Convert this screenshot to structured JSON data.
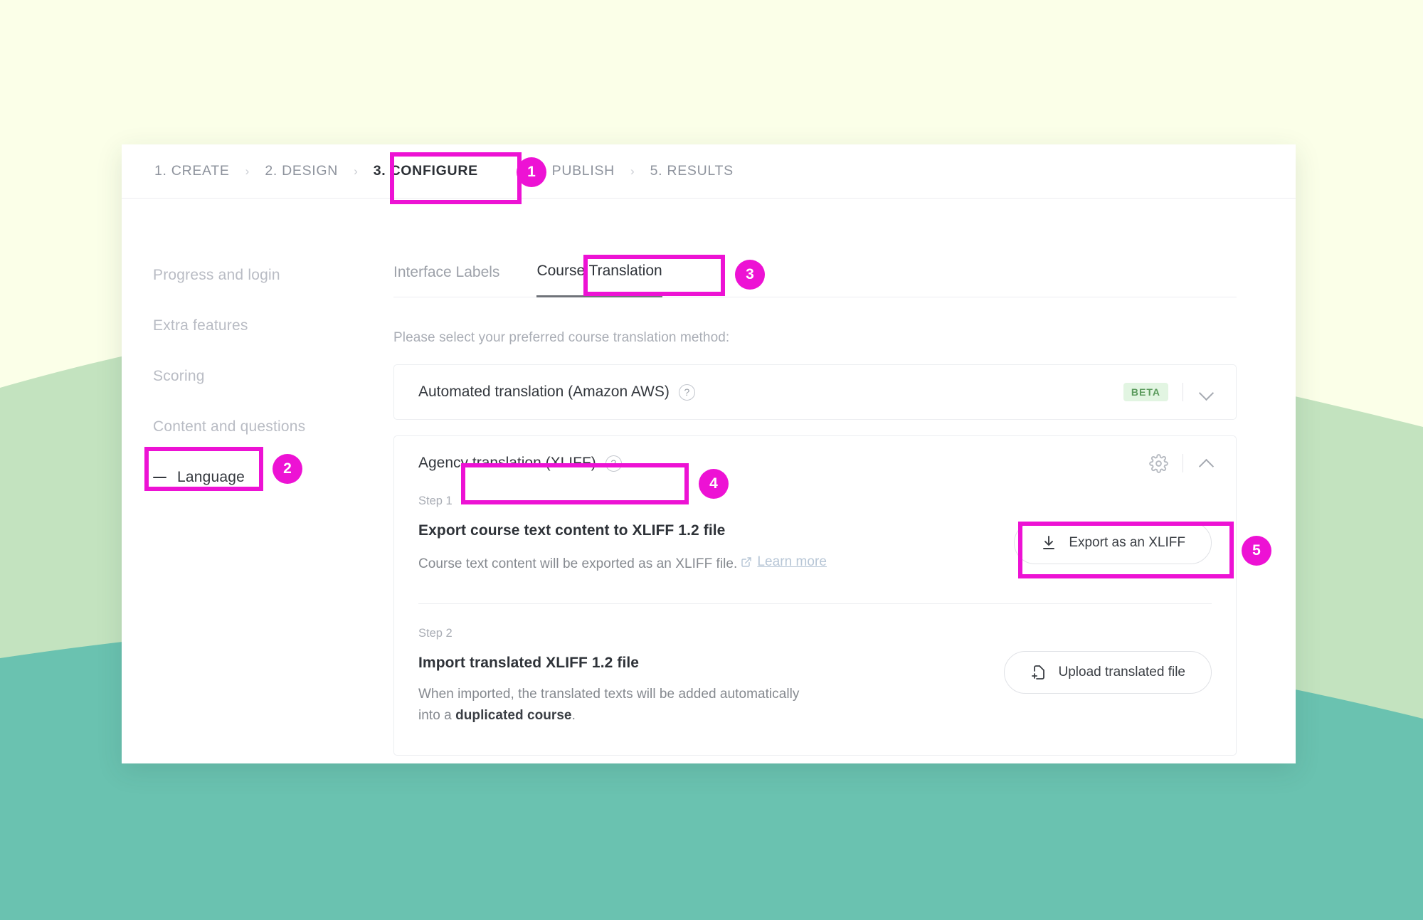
{
  "background": {
    "cream": "#fbffe8",
    "light_green": "#c3e3bf",
    "teal": "#6ac2b0"
  },
  "accent": {
    "magenta": "#ed12d4",
    "beta_green_bg": "#e2f5e2",
    "beta_green_text": "#5a9a5c",
    "link_blue": "#b7c6d6"
  },
  "steps_bar": {
    "separator": "›",
    "items": [
      {
        "label": "1. CREATE",
        "active": false
      },
      {
        "label": "2. DESIGN",
        "active": false
      },
      {
        "label": "3. CONFIGURE",
        "active": true
      },
      {
        "label": "4. PUBLISH",
        "active": false
      },
      {
        "label": "5. RESULTS",
        "active": false
      }
    ]
  },
  "side_nav": {
    "items": [
      {
        "label": "Progress and login",
        "selected": false
      },
      {
        "label": "Extra features",
        "selected": false
      },
      {
        "label": "Scoring",
        "selected": false
      },
      {
        "label": "Content and questions",
        "selected": false
      },
      {
        "label": "Language",
        "selected": true
      }
    ]
  },
  "tabs": [
    {
      "label": "Interface Labels",
      "active": false
    },
    {
      "label": "Course Translation",
      "active": true
    }
  ],
  "main": {
    "hint": "Please select your preferred course translation method:"
  },
  "automated_card": {
    "title": "Automated translation (Amazon AWS)",
    "help_glyph": "?",
    "badge": "BETA",
    "chevron": "chevron-down-icon"
  },
  "agency_card": {
    "title": "Agency translation (XLIFF)",
    "help_glyph": "?",
    "gear": "gear-icon",
    "chevron": "chevron-up-icon",
    "step1": {
      "label": "Step 1",
      "title": "Export course text content to XLIFF 1.2 file",
      "desc_prefix": "Course text content will be exported as an XLIFF file.",
      "link": "Learn more",
      "button": "Export as an XLIFF"
    },
    "step2": {
      "label": "Step 2",
      "title": "Import translated XLIFF 1.2 file",
      "desc_line1": "When imported, the translated texts will be added automatically",
      "desc_line2_prefix": "into a ",
      "desc_line2_bold": "duplicated course",
      "desc_line2_suffix": ".",
      "button": "Upload translated file"
    }
  },
  "annotations": [
    {
      "number": "1"
    },
    {
      "number": "2"
    },
    {
      "number": "3"
    },
    {
      "number": "4"
    },
    {
      "number": "5"
    }
  ]
}
